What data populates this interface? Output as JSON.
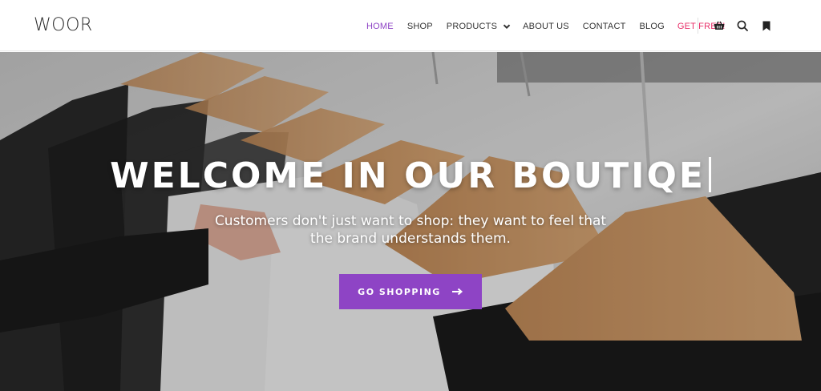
{
  "header": {
    "logo": "WOOR",
    "menu": {
      "home": "HOME",
      "shop": "SHOP",
      "products": "PRODUCTS",
      "about": "ABOUT US",
      "contact": "CONTACT",
      "blog": "BLOG",
      "get_free": "GET FREE!"
    },
    "icons": [
      "shopping-basket-icon",
      "search-icon",
      "bookmark-icon"
    ]
  },
  "hero": {
    "title": "WELCOME IN OUR BOUTIQE",
    "subtitle": "Customers don't just want to shop: they want to feel that the brand understands them.",
    "cta_label": "GO SHOPPING"
  },
  "colors": {
    "accent": "#8e44c5",
    "highlight": "#e8306a",
    "text": "#333333"
  }
}
